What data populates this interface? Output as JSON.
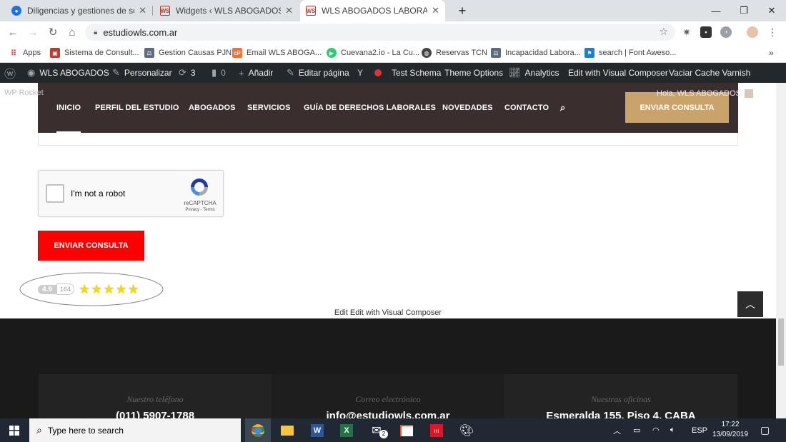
{
  "browser": {
    "tabs": [
      {
        "title": "Diligencias y gestiones de socied",
        "active": false,
        "icon": "google-drive-icon"
      },
      {
        "title": "Widgets ‹ WLS ABOGADOS — W",
        "active": false,
        "icon": "wls-favicon"
      },
      {
        "title": "WLS ABOGADOS LABORALES - R",
        "active": true,
        "icon": "wls-favicon"
      }
    ],
    "favicon_text": "WS",
    "new_tab": "+",
    "url": "estudiowls.com.ar",
    "bookmarks": [
      {
        "label": "Apps",
        "icon": "apps-grid-icon"
      },
      {
        "label": "Sistema de Consult...",
        "icon": "bookmark-icon"
      },
      {
        "label": "Gestion Causas PJN",
        "icon": "bookmark-icon"
      },
      {
        "label": "Email WLS ABOGA...",
        "icon": "cpanel-icon"
      },
      {
        "label": "Cuevana2.io - La Cu...",
        "icon": "play-icon"
      },
      {
        "label": "Reservas TCN",
        "icon": "globe-icon"
      },
      {
        "label": "Incapacidad Labora...",
        "icon": "bookmark-icon"
      },
      {
        "label": "search | Font Aweso...",
        "icon": "flag-icon"
      }
    ],
    "bookmarks_more": "»"
  },
  "adminbar": {
    "site_name": "WLS ABOGADOS",
    "customize": "Personalizar",
    "updates": "3",
    "comments": "0",
    "new": "Añadir",
    "edit_page": "Editar página",
    "test_schema": "Test Schema",
    "theme_options": "Theme Options",
    "analytics": "Analytics",
    "edit_vc": "Edit with Visual Composer",
    "varnish": "Vaciar Cache Varnish",
    "wp_rocket": "WP Rocket",
    "greeting": "Hola, WLS ABOGADOS"
  },
  "site": {
    "nav": [
      "INICIO",
      "PERFIL DEL ESTUDIO",
      "ABOGADOS",
      "SERVICIOS",
      "GUÍA DE DERECHOS LABORALES",
      "NOVEDADES",
      "CONTACTO"
    ],
    "nav_cta": "ENVIAR CONSULTA",
    "recaptcha_label": "I'm not a robot",
    "recaptcha_brand": "reCAPTCHA",
    "recaptcha_terms": "Privacy - Terms",
    "submit": "ENVIAR CONSULTA",
    "rating_score": "4.9",
    "rating_count": "164",
    "rating_stars": 5,
    "vc_edit": "Edit Edit with Visual Composer",
    "footer": [
      {
        "label": "Nuestro teléfono",
        "value": "(011) 5907-1788"
      },
      {
        "label": "Correo electrónico",
        "value": "info@estudiowls.com.ar"
      },
      {
        "label": "Nuestras oficinas",
        "value": "Esmeralda 155, Piso 4, CABA"
      }
    ]
  },
  "taskbar": {
    "search_placeholder": "Type here to search",
    "mail_badge": "2",
    "lang": "ESP",
    "time": "17:22",
    "date": "13/09/2019"
  }
}
